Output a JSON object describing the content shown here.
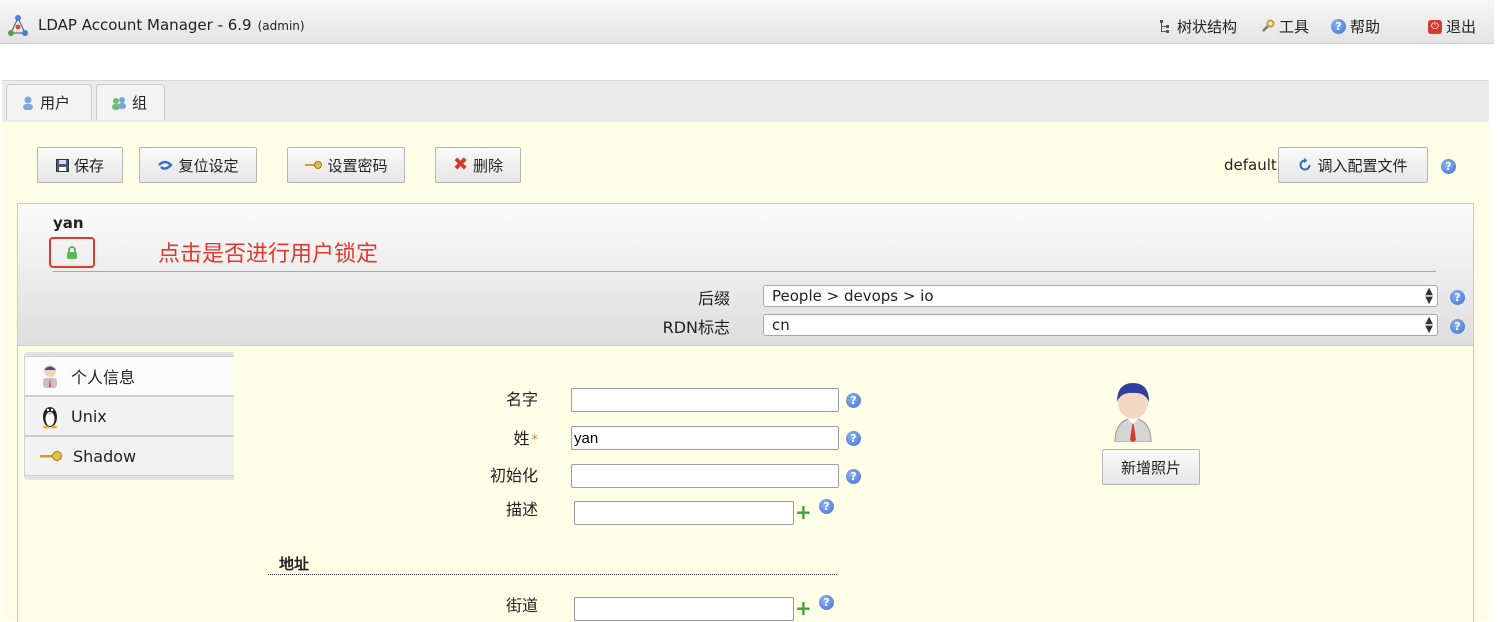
{
  "header": {
    "app_title": "LDAP Account Manager - 6.9",
    "user_role": "(admin)",
    "links": {
      "tree": "树状结构",
      "tools": "工具",
      "help": "帮助",
      "logout": "退出"
    }
  },
  "tabs": [
    {
      "label": "用户"
    },
    {
      "label": "组"
    }
  ],
  "toolbar": {
    "save": "保存",
    "reset": "复位设定",
    "set_password": "设置密码",
    "delete": "删除",
    "profile_name": "default",
    "load_profile": "调入配置文件"
  },
  "account": {
    "name": "yan",
    "annotation": "点击是否进行用户锁定",
    "suffix_label": "后缀",
    "suffix_value": "People > devops > io",
    "rdn_label": "RDN标志",
    "rdn_value": "cn"
  },
  "modules": [
    {
      "label": "个人信息",
      "icon": "person-icon"
    },
    {
      "label": "Unix",
      "icon": "penguin-icon"
    },
    {
      "label": "Shadow",
      "icon": "key-icon"
    }
  ],
  "form": {
    "first_name_label": "名字",
    "first_name_value": "",
    "last_name_label": "姓",
    "required_mark": "*",
    "last_name_value": "yan",
    "initials_label": "初始化",
    "initials_value": "",
    "description_label": "描述",
    "description_value": "",
    "address_heading": "地址",
    "street_label": "街道",
    "street_value": ""
  },
  "photo": {
    "add_button": "新增照片"
  },
  "colors": {
    "content_bg": "#ffffe8",
    "annotation_red": "#e03a2f",
    "help_blue": "#3b6fd1"
  }
}
